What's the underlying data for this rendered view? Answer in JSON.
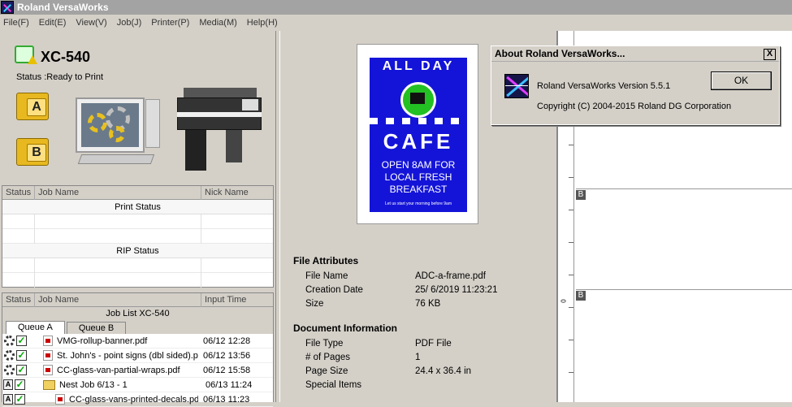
{
  "window": {
    "title": "Roland VersaWorks"
  },
  "menu": [
    "File(F)",
    "Edit(E)",
    "View(V)",
    "Job(J)",
    "Printer(P)",
    "Media(M)",
    "Help(H)"
  ],
  "printer": {
    "name": "XC-540",
    "status": "Status :Ready to Print",
    "queue_a": "A",
    "queue_b": "B"
  },
  "print_grid": {
    "headers": [
      "Status",
      "Job Name",
      "Nick Name"
    ],
    "print_status_label": "Print Status",
    "rip_status_label": "RIP Status"
  },
  "job_list": {
    "headers": [
      "Status",
      "Job Name",
      "Input Time"
    ],
    "title": "Job List XC-540",
    "tabs": [
      "Queue A",
      "Queue B"
    ],
    "rows": [
      {
        "name": "VMG-rollup-banner.pdf",
        "time": "06/12 12:28"
      },
      {
        "name": "St. John's - point signs (dbl sided).pdf",
        "time": "06/12 13:56"
      },
      {
        "name": "CC-glass-van-partial-wraps.pdf",
        "time": "06/12 15:58"
      },
      {
        "name": "Nest Job 6/13 - 1",
        "time": "06/13 11:24"
      },
      {
        "name": "CC-glass-vans-printed-decals.pdf",
        "time": "06/13 11:23"
      }
    ]
  },
  "preview": {
    "arc_text": "ALL DAY",
    "cafe": "CAFE",
    "line1": "OPEN 8AM FOR",
    "line2": "LOCAL FRESH",
    "line3": "BREAKFAST",
    "small": "Let us start your morning before 9am"
  },
  "file_attributes": {
    "title": "File Attributes",
    "rows": [
      {
        "key": "File Name",
        "value": "ADC-a-frame.pdf"
      },
      {
        "key": "Creation Date",
        "value": "25/ 6/2019 11:23:21"
      },
      {
        "key": "Size",
        "value": "76 KB"
      }
    ]
  },
  "document_information": {
    "title": "Document Information",
    "rows": [
      {
        "key": "File Type",
        "value": "PDF File"
      },
      {
        "key": "# of Pages",
        "value": "1"
      },
      {
        "key": "Page Size",
        "value": "24.4 x 36.4 in"
      },
      {
        "key": "Special Items",
        "value": ""
      }
    ]
  },
  "layout_view": {
    "marker_b1": "B",
    "marker_b2": "B",
    "ruler_label": "0"
  },
  "about_dialog": {
    "title": "About Roland VersaWorks...",
    "close": "X",
    "version": "Roland VersaWorks Version 5.5.1",
    "copyright": "Copyright (C) 2004-2015 Roland DG Corporation",
    "ok": "OK"
  }
}
